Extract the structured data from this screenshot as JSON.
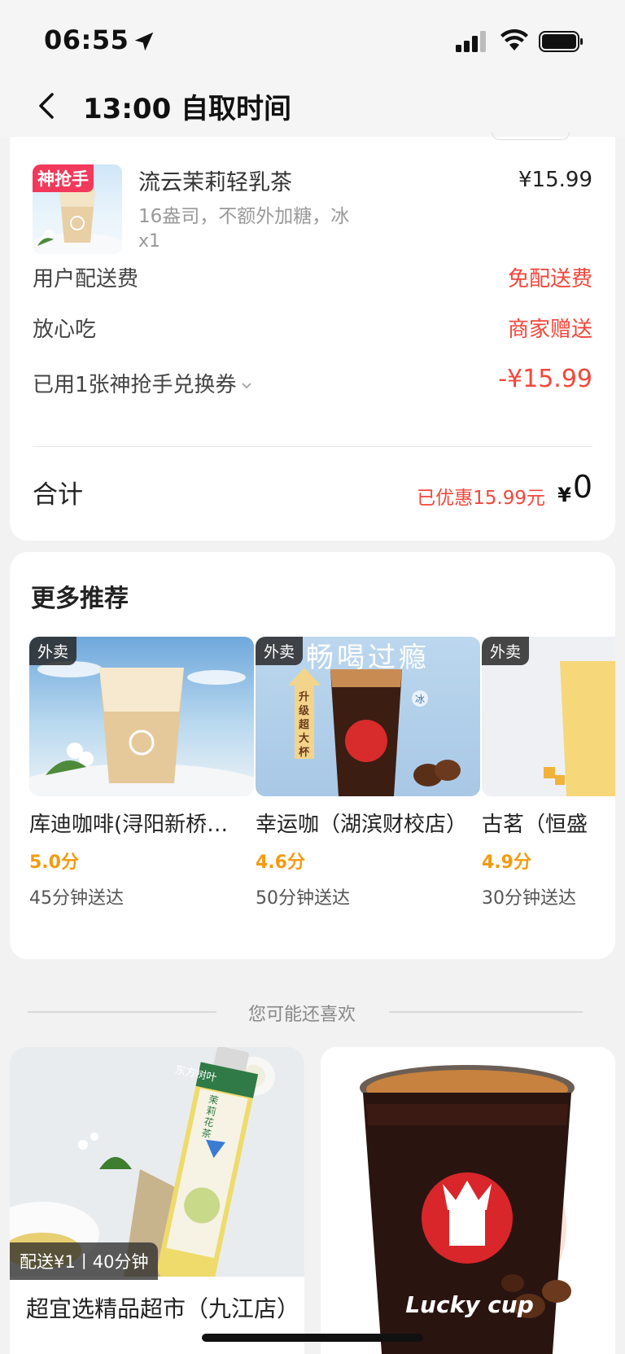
{
  "status_bar": {
    "time": "06:55"
  },
  "nav": {
    "title": "13:00 自取时间"
  },
  "order": {
    "product": {
      "tag": "神抢手",
      "name": "流云茉莉轻乳茶",
      "spec": "16盎司，不额外加糖，冰",
      "qty": "x1",
      "price": "¥15.99"
    },
    "fees": [
      {
        "label": "用户配送费",
        "value": "免配送费"
      },
      {
        "label": "放心吃",
        "value": "商家赠送"
      },
      {
        "label": "已用1张神抢手兑换券",
        "value": "-¥15.99"
      }
    ],
    "total": {
      "label": "合计",
      "discount": "已优惠15.99元",
      "currency": "¥",
      "value": "0"
    }
  },
  "recommend": {
    "title": "更多推荐",
    "items": [
      {
        "tag": "外卖",
        "name": "库迪咖啡(浔阳新桥…",
        "score": "5.0分",
        "time": "45分钟送达"
      },
      {
        "tag": "外卖",
        "name": "幸运咖（湖滨财校店）",
        "score": "4.6分",
        "time": "50分钟送达",
        "banner": "畅喝过瘾",
        "badge": "升级超大杯",
        "ice": "冰"
      },
      {
        "tag": "外卖",
        "name": "古茗（恒盛",
        "score": "4.9分",
        "time": "30分钟送达"
      }
    ]
  },
  "also_like": {
    "label": "您可能还喜欢"
  },
  "feed": [
    {
      "badge": "配送¥1丨40分钟",
      "title": "超宜选精品超市（九江店）",
      "brand": "东方树叶",
      "flavor": "茉莉花茶"
    },
    {
      "brand": "Lucky cup"
    }
  ],
  "colors": {
    "accent": "#f2473b",
    "score": "#f49b12",
    "tag": "#f2395b"
  }
}
